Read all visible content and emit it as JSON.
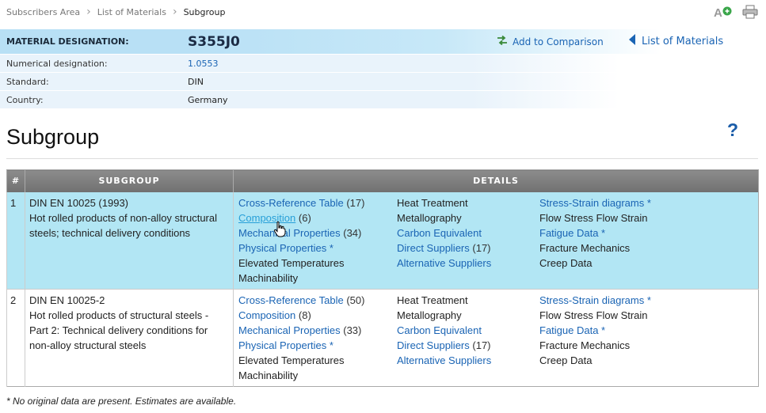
{
  "breadcrumb": [
    "Subscribers Area",
    "List of Materials",
    "Subgroup"
  ],
  "material": {
    "designation_label": "MATERIAL DESIGNATION:",
    "designation_value": "S355J0",
    "rows": [
      {
        "label": "Numerical designation:",
        "value": "1.0553"
      },
      {
        "label": "Standard:",
        "value": "DIN"
      },
      {
        "label": "Country:",
        "value": "Germany"
      }
    ],
    "add_comparison": "Add to Comparison",
    "list_of_materials": "List of Materials"
  },
  "heading": "Subgroup",
  "help": "?",
  "table": {
    "headers": [
      "#",
      "SUBGROUP",
      "DETAILS"
    ],
    "rows": [
      {
        "num": "1",
        "title": "DIN EN 10025 (1993)",
        "desc": "Hot rolled products of non-alloy structural steels; technical delivery conditions",
        "col1": [
          {
            "text": "Cross-Reference Table",
            "count": "(17)",
            "link": true
          },
          {
            "text": "Composition",
            "count": "(6)",
            "link": true
          },
          {
            "text": "Mechanical Properties",
            "count": "(34)",
            "link": true
          },
          {
            "text": "Physical Properties *",
            "count": "",
            "link": true
          },
          {
            "text": "Elevated Temperatures",
            "count": "",
            "link": false
          },
          {
            "text": "Machinability",
            "count": "",
            "link": false
          }
        ],
        "col2": [
          {
            "text": "Heat Treatment",
            "count": "",
            "link": false
          },
          {
            "text": "Metallography",
            "count": "",
            "link": false
          },
          {
            "text": "Carbon Equivalent",
            "count": "",
            "link": true
          },
          {
            "text": "Direct Suppliers",
            "count": "(17)",
            "link": true
          },
          {
            "text": "Alternative Suppliers",
            "count": "",
            "link": true
          }
        ],
        "col3": [
          {
            "text": "Stress-Strain diagrams *",
            "count": "",
            "link": true
          },
          {
            "text": "Flow Stress Flow Strain",
            "count": "",
            "link": false
          },
          {
            "text": "Fatigue Data *",
            "count": "",
            "link": true
          },
          {
            "text": "Fracture Mechanics",
            "count": "",
            "link": false
          },
          {
            "text": "Creep Data",
            "count": "",
            "link": false
          }
        ]
      },
      {
        "num": "2",
        "title": "DIN EN 10025-2",
        "desc": "Hot rolled products of structural steels - Part 2: Technical delivery conditions for non-alloy structural steels",
        "col1": [
          {
            "text": "Cross-Reference Table",
            "count": "(50)",
            "link": true
          },
          {
            "text": "Composition",
            "count": "(8)",
            "link": true
          },
          {
            "text": "Mechanical Properties",
            "count": "(33)",
            "link": true
          },
          {
            "text": "Physical Properties *",
            "count": "",
            "link": true
          },
          {
            "text": "Elevated Temperatures",
            "count": "",
            "link": false
          },
          {
            "text": "Machinability",
            "count": "",
            "link": false
          }
        ],
        "col2": [
          {
            "text": "Heat Treatment",
            "count": "",
            "link": false
          },
          {
            "text": "Metallography",
            "count": "",
            "link": false
          },
          {
            "text": "Carbon Equivalent",
            "count": "",
            "link": true
          },
          {
            "text": "Direct Suppliers",
            "count": "(17)",
            "link": true
          },
          {
            "text": "Alternative Suppliers",
            "count": "",
            "link": true
          }
        ],
        "col3": [
          {
            "text": "Stress-Strain diagrams *",
            "count": "",
            "link": true
          },
          {
            "text": "Flow Stress Flow Strain",
            "count": "",
            "link": false
          },
          {
            "text": "Fatigue Data *",
            "count": "",
            "link": true
          },
          {
            "text": "Fracture Mechanics",
            "count": "",
            "link": false
          },
          {
            "text": "Creep Data",
            "count": "",
            "link": false
          }
        ]
      }
    ]
  },
  "footnote": "* No original data are present. Estimates are available.",
  "icons": {
    "font_size": "font-size-icon",
    "print": "print-icon",
    "compare": "compare-arrows-icon",
    "back": "triangle-left-icon",
    "help": "help-icon"
  },
  "colors": {
    "accent": "#1a64b4",
    "highlight_row": "#b2e6f4",
    "header_bg": "#7e7e7e"
  }
}
